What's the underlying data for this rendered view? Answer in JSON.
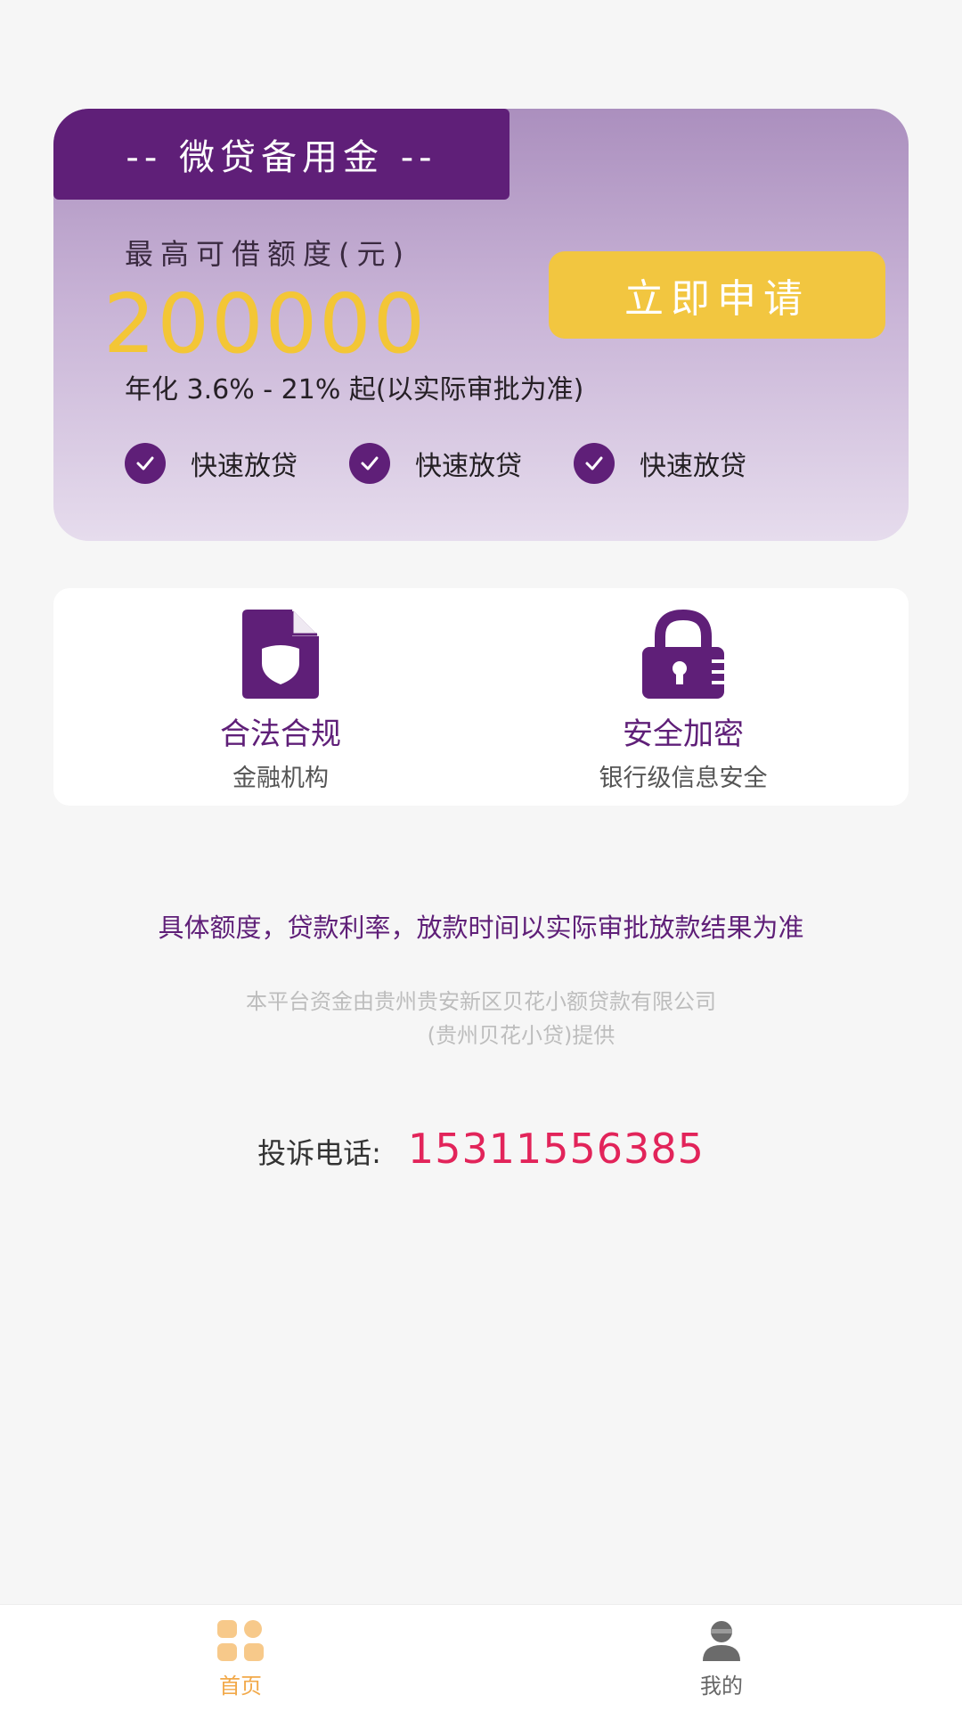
{
  "loan_card": {
    "tag": "-- 微贷备用金 --",
    "quota_label": "最高可借额度(元)",
    "quota_amount": "200000",
    "apply_label": "立即申请",
    "rate_text": "年化 3.6% - 21% 起(以实际审批为准)",
    "features": [
      {
        "label": "快速放贷"
      },
      {
        "label": "快速放贷"
      },
      {
        "label": "快速放贷"
      }
    ]
  },
  "trust": {
    "items": [
      {
        "icon": "document-shield-icon",
        "title": "合法合规",
        "subtitle": "金融机构"
      },
      {
        "icon": "lock-icon",
        "title": "安全加密",
        "subtitle": "银行级信息安全"
      }
    ]
  },
  "notice": "具体额度，贷款利率，放款时间以实际审批放款结果为准",
  "provider": {
    "line1": "本平台资金由贵州贵安新区贝花小额贷款有限公司",
    "line2": "(贵州贝花小贷)提供"
  },
  "complaint": {
    "label": "投诉电话:",
    "phone": "15311556385"
  },
  "bottom_nav": {
    "items": [
      {
        "label": "首页",
        "icon": "home-grid-icon",
        "active": true
      },
      {
        "label": "我的",
        "icon": "user-icon",
        "active": false
      }
    ]
  },
  "colors": {
    "brand": "#5f1f78",
    "accent": "#f2c640",
    "phone": "#e2245a",
    "nav_active": "#f2a94a"
  }
}
